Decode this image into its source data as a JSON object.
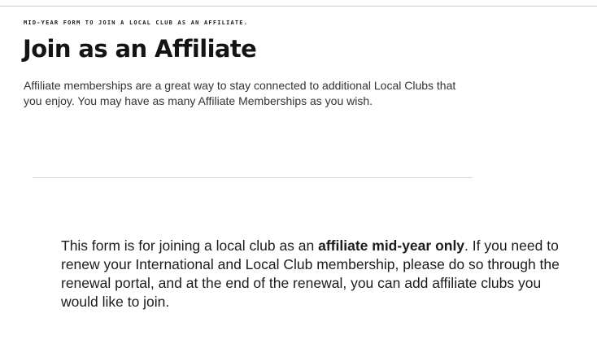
{
  "header": {
    "eyebrow": "MID-YEAR FORM TO JOIN A LOCAL CLUB AS AN AFFILIATE.",
    "title": "Join as an Affiliate",
    "intro": "Affiliate memberships are a great way to stay connected to additional Local Clubs that you enjoy. You may have as many Affiliate Memberships as you wish."
  },
  "notice": {
    "text_before": "This form is for joining a local club as an ",
    "emphasis": "affiliate mid-year only",
    "text_after": ". If you need to renew your International and Local Club membership, please do so through the renewal portal, and at the end of the renewal, you can add affiliate clubs you would like to join."
  }
}
